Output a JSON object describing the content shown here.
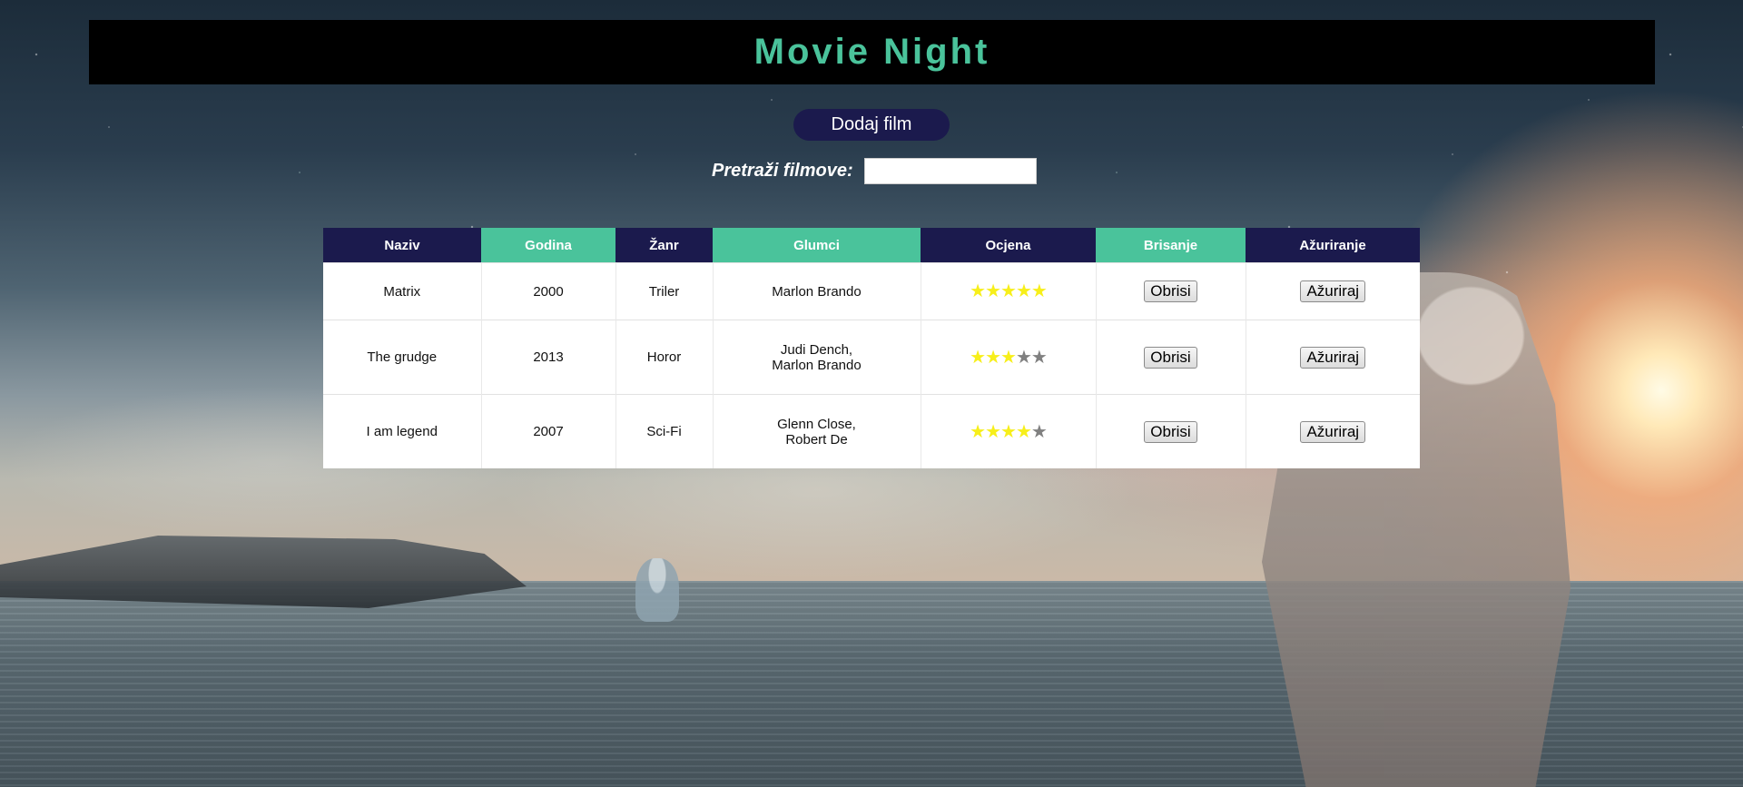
{
  "header": {
    "title": "Movie Night"
  },
  "actions": {
    "add_label": "Dodaj film"
  },
  "search": {
    "label": "Pretraži filmove:",
    "value": "",
    "placeholder": ""
  },
  "table": {
    "columns": [
      "Naziv",
      "Godina",
      "Žanr",
      "Glumci",
      "Ocjena",
      "Brisanje",
      "Ažuriranje"
    ],
    "rows": [
      {
        "naziv": "Matrix",
        "godina": "2000",
        "zanr": "Triler",
        "glumci_1": "Marlon Brando",
        "glumci_2": "",
        "ocjena": 5,
        "obrisi": "Obrisi",
        "azuriraj": "Ažuriraj"
      },
      {
        "naziv": "The grudge",
        "godina": "2013",
        "zanr": "Horor",
        "glumci_1": "Judi Dench,",
        "glumci_2": "Marlon Brando",
        "ocjena": 3,
        "obrisi": "Obrisi",
        "azuriraj": "Ažuriraj"
      },
      {
        "naziv": "I am legend",
        "godina": "2007",
        "zanr": "Sci-Fi",
        "glumci_1": "Glenn Close,",
        "glumci_2": "Robert De",
        "ocjena": 4,
        "obrisi": "Obrisi",
        "azuriraj": "Ažuriraj"
      }
    ],
    "rating_max": 5
  },
  "colors": {
    "header_bg": "#000000",
    "title": "#4ac39b",
    "navy": "#1b1a4d",
    "teal": "#4ac39b",
    "star_on": "#f7ef1a",
    "star_off": "#808080"
  },
  "icons": {
    "rating": "star-icon"
  }
}
